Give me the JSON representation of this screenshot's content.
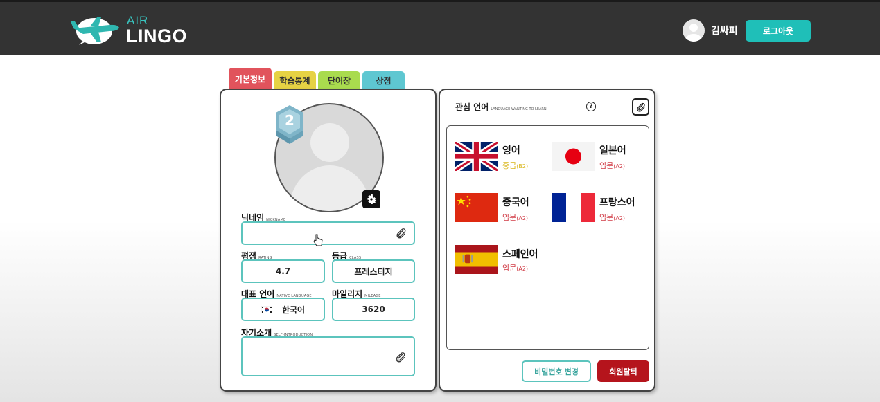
{
  "header": {
    "logo_top": "AIR",
    "logo_bottom": "LINGO",
    "user_name": "김싸피",
    "logout_label": "로그아웃"
  },
  "tabs": [
    {
      "label": "기본정보",
      "color": "#e1535c",
      "active": true
    },
    {
      "label": "학습통계",
      "color": "#e6d244",
      "active": false
    },
    {
      "label": "단어장",
      "color": "#a9db4e",
      "active": false
    },
    {
      "label": "상점",
      "color": "#5ec7d1",
      "active": false
    }
  ],
  "profile": {
    "level": "2",
    "nickname": {
      "label": "닉네임",
      "sub": "NICKNAME",
      "value": ""
    },
    "rating": {
      "label": "평점",
      "sub": "RATING",
      "value": "4.7"
    },
    "class": {
      "label": "등급",
      "sub": "CLASS",
      "value": "프레스티지"
    },
    "native_language": {
      "label": "대표 언어",
      "sub": "NATIVE LANGUAGE",
      "value": "한국어"
    },
    "mileage": {
      "label": "마일리지",
      "sub": "MILEAGE",
      "value": "3620"
    },
    "intro": {
      "label": "자기소개",
      "sub": "SELF-INTRODUCTION",
      "value": ""
    }
  },
  "interests": {
    "title": "관심 언어",
    "sub": "LANGUAGE WANTING TO LEARN",
    "help": "?",
    "languages": [
      {
        "name": "영어",
        "level": "중급",
        "level_code": "(B2)",
        "level_color": "#d9b61a",
        "flag": "uk"
      },
      {
        "name": "일본어",
        "level": "입문",
        "level_code": "(A2)",
        "level_color": "#d03a44",
        "flag": "jp"
      },
      {
        "name": "중국어",
        "level": "입문",
        "level_code": "(A2)",
        "level_color": "#d03a44",
        "flag": "cn"
      },
      {
        "name": "프랑스어",
        "level": "입문",
        "level_code": "(A2)",
        "level_color": "#d03a44",
        "flag": "fr"
      },
      {
        "name": "스페인어",
        "level": "입문",
        "level_code": "(A2)",
        "level_color": "#d03a44",
        "flag": "es"
      }
    ]
  },
  "actions": {
    "change_password": "비밀번호 변경",
    "withdraw": "회원탈퇴"
  }
}
